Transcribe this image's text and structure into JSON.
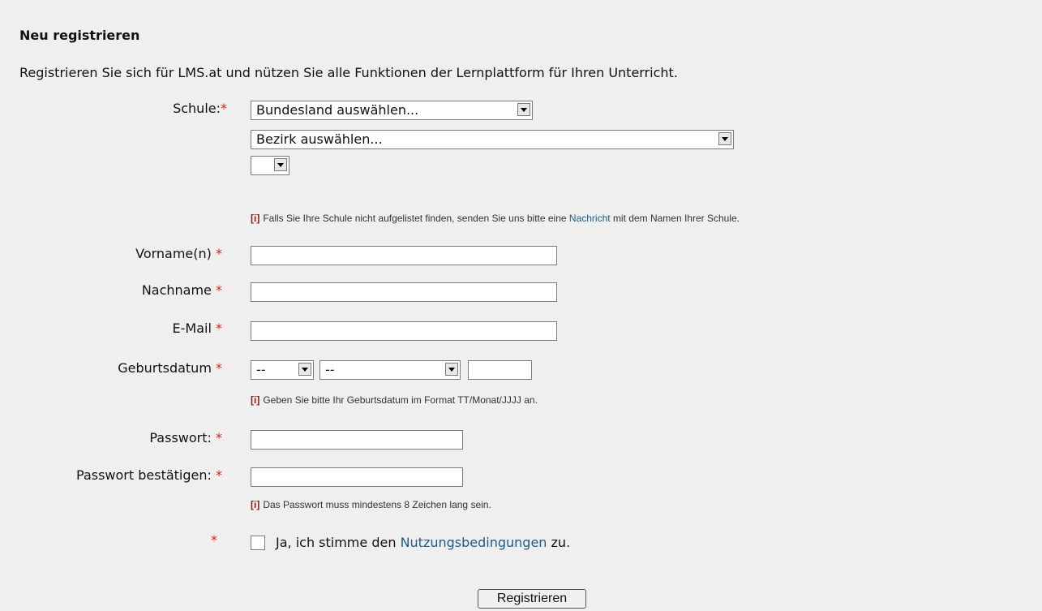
{
  "form": {
    "title": "Neu registrieren",
    "intro": "Registrieren Sie sich für LMS.at und nützen Sie alle Funktionen der Lernplattform für Ihren Unterricht.",
    "required_marker": "*",
    "school": {
      "label": "Schule:",
      "state_select": "Bundesland auswählen...",
      "district_select": "Bezirk auswählen...",
      "school_select": "",
      "hint_icon": "[i]",
      "hint_before": "Falls Sie Ihre Schule nicht aufgelistet finden, senden Sie uns bitte eine",
      "hint_link": "Nachricht",
      "hint_after": "mit dem Namen Ihrer Schule."
    },
    "firstname": {
      "label": "Vorname(n)",
      "value": ""
    },
    "lastname": {
      "label": "Nachname",
      "value": ""
    },
    "email": {
      "label": "E-Mail",
      "value": ""
    },
    "birthdate": {
      "label": "Geburtsdatum",
      "day": "--",
      "month": "--",
      "year": "",
      "hint_icon": "[i]",
      "hint": "Geben Sie bitte Ihr Geburtsdatum im Format TT/Monat/JJJJ an."
    },
    "password": {
      "label": "Passwort:",
      "value": ""
    },
    "password_confirm": {
      "label": "Passwort bestätigen:",
      "value": "",
      "hint_icon": "[i]",
      "hint": "Das Passwort muss mindestens 8 Zeichen lang sein."
    },
    "terms": {
      "before": "Ja, ich stimme den",
      "link": "Nutzungsbedingungen",
      "after": "zu.",
      "checked": false
    },
    "submit_label": "Registrieren"
  }
}
